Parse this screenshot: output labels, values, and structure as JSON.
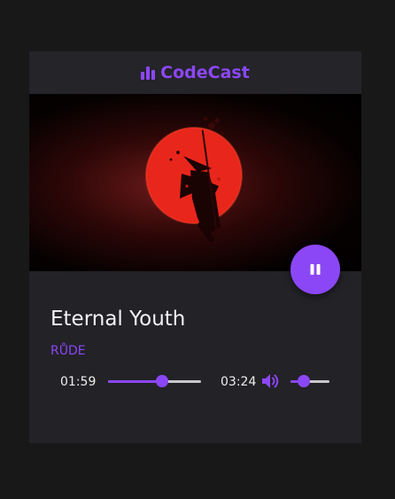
{
  "app": {
    "brand_name": "CodeCast",
    "brand_icon": "bar-chart-icon",
    "accent_color": "#8b47f5"
  },
  "track": {
    "title": "Eternal Youth",
    "artist": "RŮDE",
    "artwork": "samurai silhouette in front of a red sun on a dark red background"
  },
  "controls": {
    "play_state_icon": "pause-icon",
    "current_time": "01:59",
    "total_time": "03:24",
    "progress_fraction": 0.58,
    "volume_icon": "volume-high-icon",
    "volume_fraction": 0.35
  }
}
